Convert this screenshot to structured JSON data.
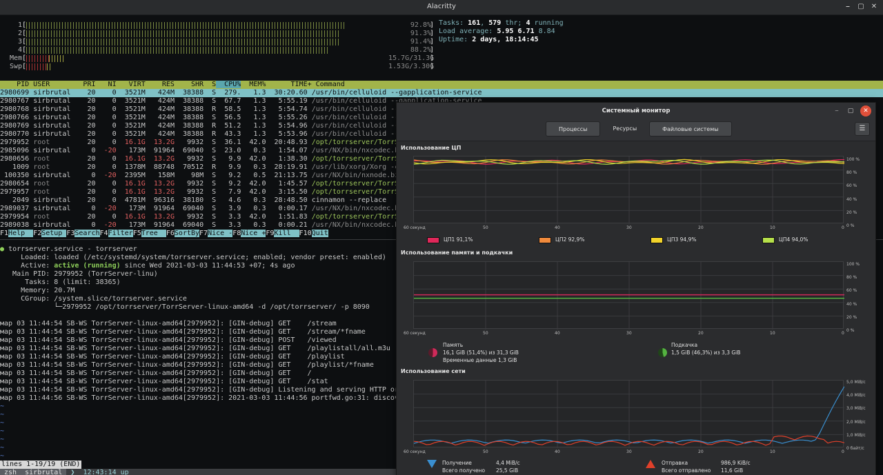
{
  "window": {
    "title": "Alacritty"
  },
  "meters": [
    {
      "label": "1",
      "value": "92.8%",
      "fraction": 0.928
    },
    {
      "label": "2",
      "value": "91.3%",
      "fraction": 0.913
    },
    {
      "label": "3",
      "value": "91.4%",
      "fraction": 0.914
    },
    {
      "label": "4",
      "value": "88.2%",
      "fraction": 0.882
    },
    {
      "label": "Mem",
      "value": "15.7G/31.3G",
      "fraction": 0.5
    },
    {
      "label": "Swp",
      "value": "1.53G/3.30G",
      "fraction": 0.46
    }
  ],
  "sysinfo": {
    "tasks_label": "Tasks:",
    "tasks": "161",
    "thr": "579",
    "thr_label": "thr;",
    "running": "4",
    "running_label": "running",
    "load_label": "Load average:",
    "load1": "5.95",
    "load5": "6.71",
    "load15": "8.84",
    "uptime_label": "Uptime:",
    "uptime": "2 days, 18:14:45"
  },
  "process_header": [
    "PID",
    "USER",
    "PRI",
    "NI",
    "VIRT",
    "RES",
    "SHR",
    "S",
    "CPU%",
    "MEM%",
    "TIME+",
    "Command"
  ],
  "processes": [
    {
      "pid": "2980699",
      "user": "sirbrutal",
      "pri": "20",
      "ni": "0",
      "virt": "3521M",
      "res": "424M",
      "shr": "38388",
      "s": "S",
      "cpu": "279.",
      "mem": "1.3",
      "time": "30:20.60",
      "cmd": "/usr/bin/celluloid --gapplication-service"
    },
    {
      "pid": "2980767",
      "user": "sirbrutal",
      "pri": "20",
      "ni": "0",
      "virt": "3521M",
      "res": "424M",
      "shr": "38388",
      "s": "S",
      "cpu": "67.7",
      "mem": "1.3",
      "time": "5:55.19",
      "cmd": "/usr/bin/celluloid --gapplication-service"
    },
    {
      "pid": "2980768",
      "user": "sirbrutal",
      "pri": "20",
      "ni": "0",
      "virt": "3521M",
      "res": "424M",
      "shr": "38388",
      "s": "R",
      "cpu": "58.5",
      "mem": "1.3",
      "time": "5:54.74",
      "cmd": "/usr/bin/celluloid --gapplicati"
    },
    {
      "pid": "2980766",
      "user": "sirbrutal",
      "pri": "20",
      "ni": "0",
      "virt": "3521M",
      "res": "424M",
      "shr": "38388",
      "s": "S",
      "cpu": "56.5",
      "mem": "1.3",
      "time": "5:55.26",
      "cmd": "/usr/bin/celluloid --gapplicati"
    },
    {
      "pid": "2980769",
      "user": "sirbrutal",
      "pri": "20",
      "ni": "0",
      "virt": "3521M",
      "res": "424M",
      "shr": "38388",
      "s": "R",
      "cpu": "51.2",
      "mem": "1.3",
      "time": "5:54.96",
      "cmd": "/usr/bin/celluloid --gapplicati"
    },
    {
      "pid": "2980770",
      "user": "sirbrutal",
      "pri": "20",
      "ni": "0",
      "virt": "3521M",
      "res": "424M",
      "shr": "38388",
      "s": "R",
      "cpu": "43.3",
      "mem": "1.3",
      "time": "5:53.96",
      "cmd": "/usr/bin/celluloid --gapplicati"
    },
    {
      "pid": "2979952",
      "user": "root",
      "pri": "20",
      "ni": "0",
      "virt": "16.1G",
      "res": "13.2G",
      "shr": "9932",
      "s": "S",
      "cpu": "36.1",
      "mem": "42.0",
      "time": "20:48.93",
      "cmd": "/opt/torrserver/TorrServer-linu"
    },
    {
      "pid": "2985096",
      "user": "sirbrutal",
      "pri": "0",
      "ni": "-20",
      "virt": "173M",
      "res": "91964",
      "shr": "69040",
      "s": "S",
      "cpu": "23.0",
      "mem": "0.3",
      "time": "1:54.07",
      "cmd": "/usr/NX/bin/nxcodec.bin"
    },
    {
      "pid": "2980656",
      "user": "root",
      "pri": "20",
      "ni": "0",
      "virt": "16.1G",
      "res": "13.2G",
      "shr": "9932",
      "s": "S",
      "cpu": "9.9",
      "mem": "42.0",
      "time": "1:38.30",
      "cmd": "/opt/torrserver/TorrServer-linu"
    },
    {
      "pid": "1009",
      "user": "root",
      "pri": "20",
      "ni": "0",
      "virt": "1378M",
      "res": "88748",
      "shr": "70512",
      "s": "R",
      "cpu": "9.9",
      "mem": "0.3",
      "time": "28:19.91",
      "cmd": "/usr/lib/xorg/Xorg -core :0 -se"
    },
    {
      "pid": "100350",
      "user": "sirbrutal",
      "pri": "0",
      "ni": "-20",
      "virt": "2395M",
      "res": "158M",
      "shr": "98M",
      "s": "S",
      "cpu": "9.2",
      "mem": "0.5",
      "time": "21:13.75",
      "cmd": "/usr/NX/bin/nxnode.bin"
    },
    {
      "pid": "2980654",
      "user": "root",
      "pri": "20",
      "ni": "0",
      "virt": "16.1G",
      "res": "13.2G",
      "shr": "9932",
      "s": "S",
      "cpu": "9.2",
      "mem": "42.0",
      "time": "1:45.57",
      "cmd": "/opt/torrserver/TorrServer-linu"
    },
    {
      "pid": "2979957",
      "user": "root",
      "pri": "20",
      "ni": "0",
      "virt": "16.1G",
      "res": "13.2G",
      "shr": "9932",
      "s": "S",
      "cpu": "7.9",
      "mem": "42.0",
      "time": "3:15.50",
      "cmd": "/opt/torrserver/TorrServer-linu"
    },
    {
      "pid": "2049",
      "user": "sirbrutal",
      "pri": "20",
      "ni": "0",
      "virt": "4781M",
      "res": "96316",
      "shr": "38180",
      "s": "S",
      "cpu": "4.6",
      "mem": "0.3",
      "time": "28:48.50",
      "cmd": "cinnamon --replace"
    },
    {
      "pid": "2989037",
      "user": "sirbrutal",
      "pri": "0",
      "ni": "-20",
      "virt": "173M",
      "res": "91964",
      "shr": "69040",
      "s": "S",
      "cpu": "3.9",
      "mem": "0.3",
      "time": "0:00.17",
      "cmd": "/usr/NX/bin/nxcodec.bin"
    },
    {
      "pid": "2979954",
      "user": "root",
      "pri": "20",
      "ni": "0",
      "virt": "16.1G",
      "res": "13.2G",
      "shr": "9932",
      "s": "S",
      "cpu": "3.3",
      "mem": "42.0",
      "time": "1:51.83",
      "cmd": "/opt/torrserver/TorrServer-linu"
    },
    {
      "pid": "2989038",
      "user": "sirbrutal",
      "pri": "0",
      "ni": "-20",
      "virt": "173M",
      "res": "91964",
      "shr": "69040",
      "s": "S",
      "cpu": "3.3",
      "mem": "0.3",
      "time": "0:00.21",
      "cmd": "/usr/NX/bin/nxcodec.bin"
    }
  ],
  "fkeys": [
    {
      "key": "F1",
      "label": "Help  "
    },
    {
      "key": "F2",
      "label": "Setup "
    },
    {
      "key": "F3",
      "label": "Search"
    },
    {
      "key": "F4",
      "label": "Filter"
    },
    {
      "key": "F5",
      "label": "Tree  "
    },
    {
      "key": "F6",
      "label": "SortBy"
    },
    {
      "key": "F7",
      "label": "Nice -"
    },
    {
      "key": "F8",
      "label": "Nice +"
    },
    {
      "key": "F9",
      "label": "Kill  "
    },
    {
      "key": "F10",
      "label": "Quit"
    }
  ],
  "service": {
    "dot": "●",
    "line1": "torrserver.service - torrserver",
    "loaded": "     Loaded: loaded (/etc/systemd/system/torrserver.service; enabled; vendor preset: enabled)",
    "active_prefix": "     Active: ",
    "active_state": "active (running)",
    "active_suffix": " since Wed 2021-03-03 11:44:53 +07; 4s ago",
    "mainpid": "   Main PID: 2979952 (TorrServer-linu)",
    "tasks": "      Tasks: 8 (limit: 38365)",
    "memory": "     Memory: 20.7M",
    "cgroup": "     CGroup: /system.slice/torrserver.service",
    "cgroup2": "             └─2979952 /opt/torrserver/TorrServer-linux-amd64 -d /opt/torrserver/ -p 8090"
  },
  "journal": [
    "мар 03 11:44:54 SB-WS TorrServer-linux-amd64[2979952]: [GIN-debug] GET    /stream",
    "мар 03 11:44:54 SB-WS TorrServer-linux-amd64[2979952]: [GIN-debug] GET    /stream/*fname",
    "мар 03 11:44:54 SB-WS TorrServer-linux-amd64[2979952]: [GIN-debug] POST   /viewed",
    "мар 03 11:44:54 SB-WS TorrServer-linux-amd64[2979952]: [GIN-debug] GET    /playlistall/all.m3u",
    "мар 03 11:44:54 SB-WS TorrServer-linux-amd64[2979952]: [GIN-debug] GET    /playlist",
    "мар 03 11:44:54 SB-WS TorrServer-linux-amd64[2979952]: [GIN-debug] GET    /playlist/*fname",
    "мар 03 11:44:54 SB-WS TorrServer-linux-amd64[2979952]: [GIN-debug] GET    /",
    "мар 03 11:44:54 SB-WS TorrServer-linux-amd64[2979952]: [GIN-debug] GET    /stat",
    "мар 03 11:44:54 SB-WS TorrServer-linux-amd64[2979952]: [GIN-debug] Listening and serving HTTP or",
    "мар 03 11:44:56 SB-WS TorrServer-linux-amd64[2979952]: 2021-03-03 11:44:56 portfwd.go:31: discov"
  ],
  "tildes": [
    "~",
    "~",
    "~",
    "~",
    "~",
    "~",
    "~"
  ],
  "pager_status": "lines 1-19/19 (END)",
  "prompt": {
    "shell": " zsh ",
    "user": " sirbrutal ",
    "sep": "❯",
    "time": " 12:43:14 up"
  },
  "sysmon": {
    "title": "Системный монитор",
    "tabs": [
      "Процессы",
      "Ресурсы",
      "Файловые системы"
    ],
    "cpu_title": "Использование ЦП",
    "mem_title": "Использование памяти и подкачки",
    "net_title": "Использование сети",
    "x_ticks": [
      "60 секунд",
      "50",
      "40",
      "30",
      "20",
      "10",
      "0"
    ],
    "pct_ticks": [
      "100 %",
      "80 %",
      "60 %",
      "40 %",
      "20 %",
      "0 %"
    ],
    "net_ticks": [
      "5,0 MiB/c",
      "4,0 MiB/c",
      "3,0 MiB/c",
      "2,0 MiB/c",
      "1,0 MiB/c",
      "0 байт/c"
    ],
    "cpu_legend": [
      {
        "name": "ЦП1",
        "value": "91,1%",
        "color": "#e0285a"
      },
      {
        "name": "ЦП2",
        "value": "92,9%",
        "color": "#f08a3c"
      },
      {
        "name": "ЦП3",
        "value": "94,9%",
        "color": "#f2d32a"
      },
      {
        "name": "ЦП4",
        "value": "94,0%",
        "color": "#b6e04a"
      }
    ],
    "mem": {
      "label": "Память",
      "value": "16,1 GiB (51,4%) из 31,3 GiB",
      "cache": "Временные данные 1,3 GiB",
      "color": "#d02a5a",
      "fraction": 0.514
    },
    "swap": {
      "label": "Подкачка",
      "value": "1,5 GiB (46,3%) из 3,3 GiB",
      "color": "#54b340",
      "fraction": 0.463
    },
    "rx": {
      "label": "Получение",
      "rate": "4,4 MiB/c",
      "total_label": "Всего получено",
      "total": "25,5 GiB",
      "color": "#3a8fd0"
    },
    "tx": {
      "label": "Отправка",
      "rate": "986,9 KiB/c",
      "total_label": "Всего отправлено",
      "total": "11,6 GiB",
      "color": "#e0402a"
    }
  }
}
